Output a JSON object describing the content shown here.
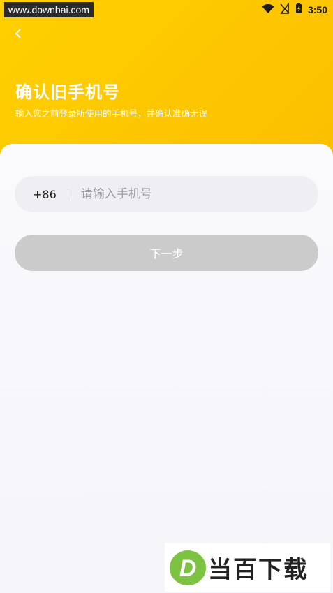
{
  "status_bar": {
    "watermark": "www.downbai.com",
    "time": "3:50",
    "icons": [
      "wifi-icon",
      "no-signal-icon",
      "battery-charging-icon"
    ]
  },
  "header": {
    "back_icon": "chevron-left-icon",
    "title": "确认旧手机号",
    "subtitle": "输入您之前登录所使用的手机号，并确认准确无误"
  },
  "form": {
    "country_code": "+86",
    "phone_placeholder": "请输入手机号",
    "phone_value": "",
    "next_label": "下一步"
  },
  "watermark_logo": {
    "text": "当百下载",
    "letter": "D"
  },
  "colors": {
    "header_yellow": "#fcc400",
    "disabled_button": "#cbcbcb",
    "field_background": "#efeff3"
  }
}
